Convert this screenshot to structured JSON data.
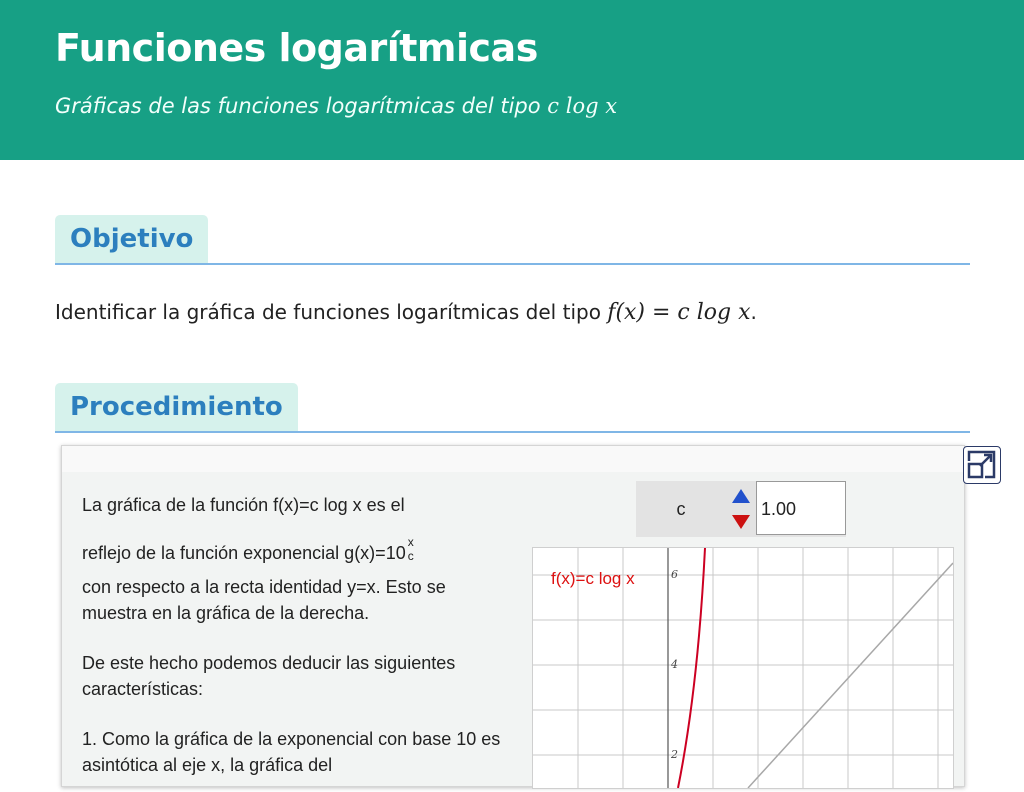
{
  "header": {
    "title": "Funciones logarítmicas",
    "subtitle_text": "Gráficas de las funciones logarítmicas del tipo ",
    "subtitle_math": "c log x"
  },
  "sections": {
    "objetivo": "Objetivo",
    "procedimiento": "Procedimiento"
  },
  "objective": {
    "text": "Identificar la gráfica de funciones logarítmicas del tipo ",
    "math": "f(x) = c log x",
    "end": "."
  },
  "panel": {
    "p1_line1": "La gráfica de la función f(x)=c log x es el",
    "p1_line2": "reflejo de la función exponencial g(x)=10",
    "p1_exp_num": "x",
    "p1_exp_den": "c",
    "p1_line3": "con respecto a la recta identidad y=x. Esto se muestra en la gráfica de la derecha.",
    "p2": "De este hecho podemos deducir las siguientes características:",
    "p3": "1. Como la gráfica de la exponencial con base 10 es asintótica al eje x, la gráfica del"
  },
  "control": {
    "label": "c",
    "value": "1.00"
  },
  "graph": {
    "curve_label": "f(x)=c log x",
    "y_ticks": [
      "6",
      "4",
      "2"
    ]
  },
  "colors": {
    "header_bg": "#17a085",
    "section_title": "#2c7fbe",
    "section_tab_bg": "#d6f2ec",
    "curve": "#cc0022",
    "spin_up": "#2251cc",
    "spin_down": "#cc1111"
  }
}
